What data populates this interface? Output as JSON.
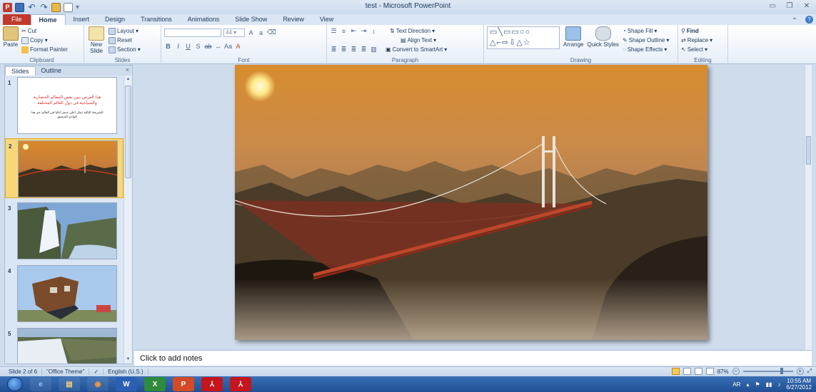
{
  "window": {
    "title": "test - Microsoft PowerPoint",
    "ppt_logo": "P"
  },
  "tabs": [
    {
      "label": "File"
    },
    {
      "label": "Home"
    },
    {
      "label": "Insert"
    },
    {
      "label": "Design"
    },
    {
      "label": "Transitions"
    },
    {
      "label": "Animations"
    },
    {
      "label": "Slide Show"
    },
    {
      "label": "Review"
    },
    {
      "label": "View"
    }
  ],
  "ribbon": {
    "clipboard": {
      "paste": "Paste",
      "cut": "Cut",
      "copy": "Copy",
      "format_painter": "Format Painter",
      "label": "Clipboard"
    },
    "slides": {
      "new_slide": "New Slide",
      "layout": "Layout",
      "reset": "Reset",
      "section": "Section",
      "label": "Slides"
    },
    "font": {
      "size": "44",
      "label": "Font"
    },
    "paragraph": {
      "text_direction": "Text Direction",
      "align_text": "Align Text",
      "convert_smartart": "Convert to SmartArt",
      "label": "Paragraph"
    },
    "drawing": {
      "arrange": "Arrange",
      "quick_styles": "Quick Styles",
      "shape_fill": "Shape Fill",
      "shape_outline": "Shape Outline",
      "shape_effects": "Shape Effects",
      "label": "Drawing"
    },
    "editing": {
      "find": "Find",
      "replace": "Replace",
      "select": "Select",
      "label": "Editing"
    }
  },
  "panel": {
    "tab_slides": "Slides",
    "tab_outline": "Outline",
    "close": "×",
    "slide_numbers": [
      "1",
      "2",
      "3",
      "4",
      "5"
    ],
    "slide1_title": "هذا العرض يبين بعض المعالم الحضارية والسياحية في دول العالم المختلفة",
    "slide1_sub": "الشريحة التالية تمثل اعلى جسر انكيا في العالم عبر هذا الوادي السحيق"
  },
  "notes": {
    "placeholder": "Click to add notes"
  },
  "status": {
    "slide_info": "Slide 2 of 6",
    "theme": "\"Office Theme\"",
    "language": "English (U.S.)",
    "zoom": "87%"
  },
  "taskbar": {
    "lang": "AR",
    "time": "10:55 AM",
    "date": "6/27/2012"
  },
  "colors": {
    "file_tab": "#c0392b",
    "ribbon_bg": "#dbe6f4",
    "selected_thumb": "#f6d77a",
    "taskbar": "#2a5ea6"
  }
}
